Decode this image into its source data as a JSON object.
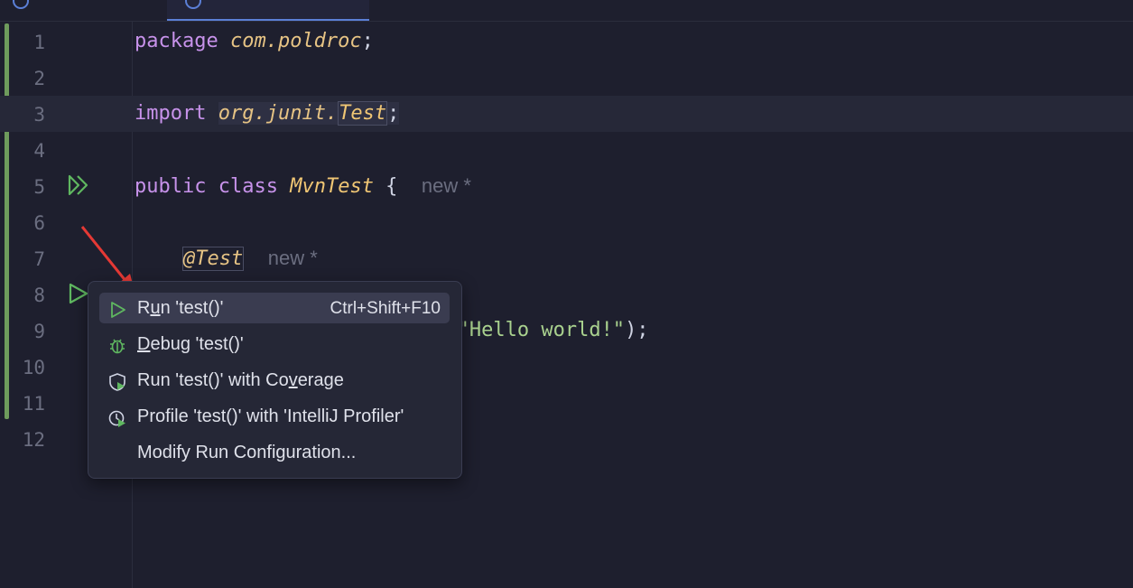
{
  "editor": {
    "lines": [
      {
        "number": "1",
        "tokens": [
          {
            "cls": "kw",
            "text": "package"
          },
          {
            "cls": "",
            "text": " "
          },
          {
            "cls": "pkg",
            "text": "com.poldroc"
          },
          {
            "cls": "",
            "text": ";"
          }
        ]
      },
      {
        "number": "2",
        "tokens": []
      },
      {
        "number": "3",
        "tokens": [
          {
            "cls": "kw",
            "text": "import"
          },
          {
            "cls": "",
            "text": " "
          },
          {
            "cls": "pkg imp-box",
            "text": "org.junit."
          },
          {
            "cls": "cls imp-box word-box",
            "text": "Test"
          },
          {
            "cls": "imp-box",
            "text": ";"
          }
        ]
      },
      {
        "number": "4",
        "tokens": []
      },
      {
        "number": "5",
        "tokens": [
          {
            "cls": "kw",
            "text": "public"
          },
          {
            "cls": "",
            "text": " "
          },
          {
            "cls": "kw",
            "text": "class"
          },
          {
            "cls": "",
            "text": " "
          },
          {
            "cls": "cls",
            "text": "MvnTest"
          },
          {
            "cls": "",
            "text": " {  "
          },
          {
            "cls": "hint",
            "text": "new *"
          }
        ]
      },
      {
        "number": "6",
        "tokens": []
      },
      {
        "number": "7",
        "tokens": [
          {
            "cls": "",
            "text": "    "
          },
          {
            "cls": "ann word-box",
            "text": "@Test"
          },
          {
            "cls": "",
            "text": "  "
          },
          {
            "cls": "hint",
            "text": "new *"
          }
        ]
      },
      {
        "number": "8",
        "tokens": []
      },
      {
        "number": "9",
        "tokens": [
          {
            "cls": "",
            "text": "                          ("
          },
          {
            "cls": "str",
            "text": "\"Hello world!\""
          },
          {
            "cls": "",
            "text": ");"
          }
        ]
      },
      {
        "number": "10",
        "tokens": []
      },
      {
        "number": "11",
        "tokens": []
      },
      {
        "number": "12",
        "tokens": []
      }
    ],
    "current_line": "3"
  },
  "context_menu": {
    "items": [
      {
        "name": "run-test-item",
        "label_pre": "R",
        "label_u": "u",
        "label_post": "n 'test()'",
        "shortcut": "Ctrl+Shift+F10",
        "icon": "run-icon",
        "selected": true
      },
      {
        "name": "debug-test-item",
        "label_pre": "",
        "label_u": "D",
        "label_post": "ebug 'test()'",
        "shortcut": "",
        "icon": "debug-icon",
        "selected": false
      },
      {
        "name": "run-with-coverage-item",
        "label_pre": "Run 'test()' with Co",
        "label_u": "v",
        "label_post": "erage",
        "shortcut": "",
        "icon": "coverage-icon",
        "selected": false
      },
      {
        "name": "profile-test-item",
        "label_pre": "Profile 'test()' with 'IntelliJ Profiler'",
        "label_u": "",
        "label_post": "",
        "shortcut": "",
        "icon": "profiler-icon",
        "selected": false
      },
      {
        "name": "modify-run-config-item",
        "label_pre": "Modify Run Configuration...",
        "label_u": "",
        "label_post": "",
        "shortcut": "",
        "icon": "",
        "selected": false
      }
    ]
  },
  "colors": {
    "background": "#1e1f2e",
    "keyword": "#c792ea",
    "class": "#f0c674",
    "string": "#a9d18e",
    "run_green": "#5fb760",
    "arrow_red": "#e53935"
  }
}
